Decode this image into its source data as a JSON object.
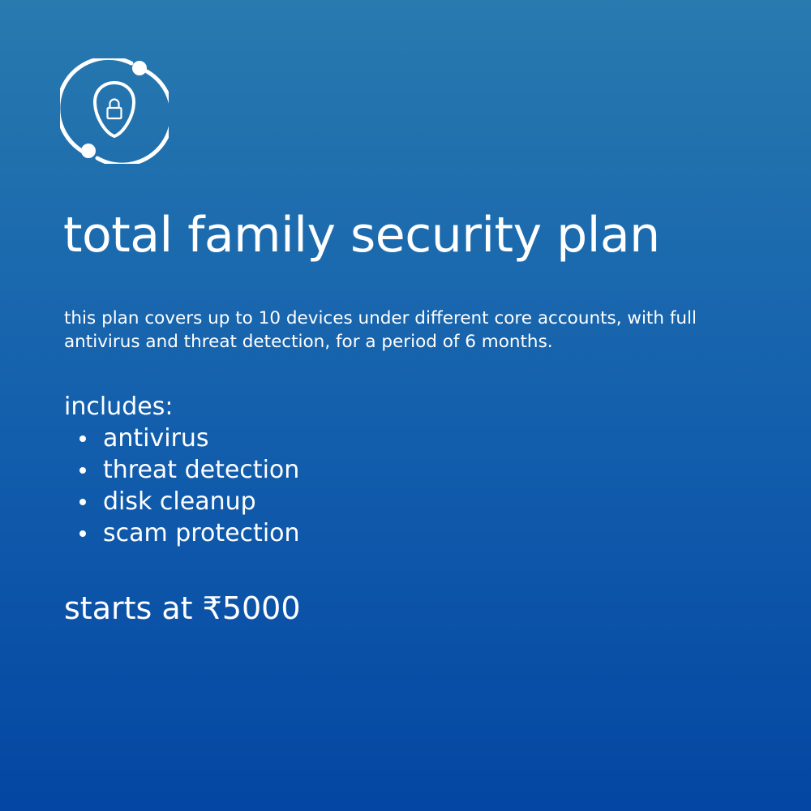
{
  "colors": {
    "gradient_top": "#287aaf",
    "gradient_bottom": "#0346a3",
    "text": "#ffffff"
  },
  "logo": {
    "icon": "shield-lock-orbit-icon"
  },
  "plan": {
    "title": "total family security plan",
    "description": "this plan covers up to 10 devices under different core accounts, with full antivirus and threat detection, for a period of 6 months.",
    "includes_heading": "includes:",
    "features": [
      "antivirus",
      "threat detection",
      "disk cleanup",
      "scam protection"
    ],
    "price_text": "starts at ₹5000"
  }
}
